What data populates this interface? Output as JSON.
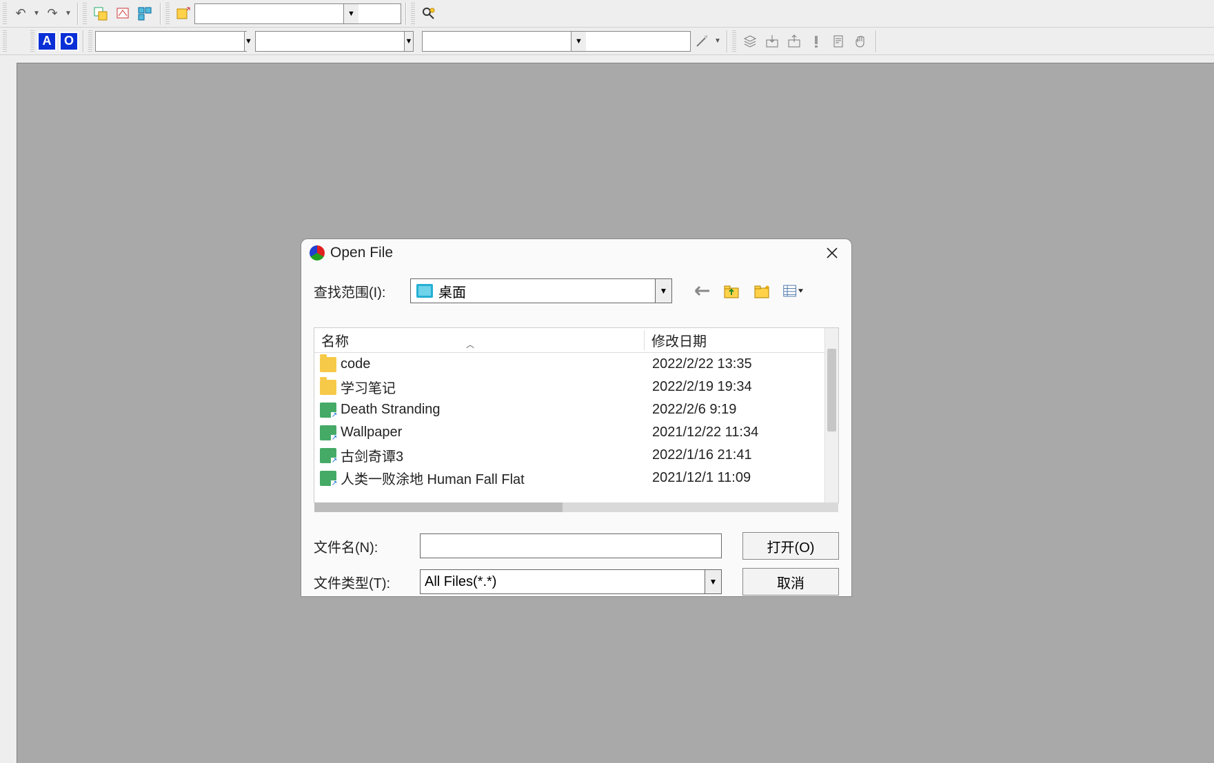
{
  "toolbar": {
    "badge_a": "A",
    "badge_o": "O",
    "combo_main": "",
    "combo_a": "",
    "combo_b": "",
    "combo_c": ""
  },
  "dialog": {
    "title": "Open File",
    "lookin_label": "查找范围(I):",
    "lookin_value": "桌面",
    "columns": {
      "name": "名称",
      "date": "修改日期"
    },
    "files": [
      {
        "name": "code",
        "date": "2022/2/22 13:35",
        "kind": "folder"
      },
      {
        "name": "学习笔记",
        "date": "2022/2/19 19:34",
        "kind": "folder"
      },
      {
        "name": "Death Stranding",
        "date": "2022/2/6 9:19",
        "kind": "shortcut"
      },
      {
        "name": "Wallpaper",
        "date": "2021/12/22 11:34",
        "kind": "shortcut"
      },
      {
        "name": "古剑奇谭3",
        "date": "2022/1/16 21:41",
        "kind": "shortcut"
      },
      {
        "name": "人类一败涂地  Human Fall Flat",
        "date": "2021/12/1 11:09",
        "kind": "shortcut"
      }
    ],
    "filename_label": "文件名(N):",
    "filename_value": "",
    "filetype_label": "文件类型(T):",
    "filetype_value": "All Files(*.*)",
    "open_btn": "打开(O)",
    "cancel_btn": "取消"
  }
}
